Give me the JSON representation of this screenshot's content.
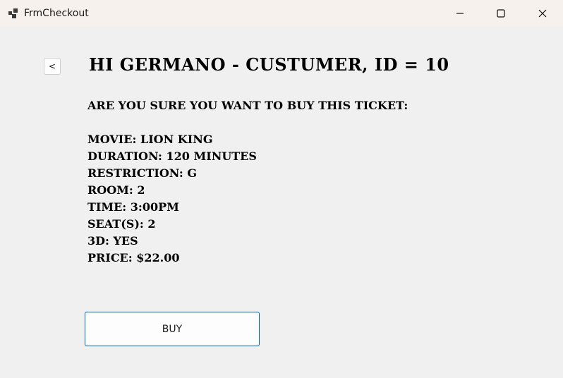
{
  "window": {
    "title": "FrmCheckout"
  },
  "back_button": {
    "label": "<"
  },
  "header": {
    "greeting": "Hi Germano - Custumer, ID = 10"
  },
  "confirmation": {
    "question": "Are you sure you want to buy this ticket:"
  },
  "ticket": {
    "movie": "Movie: Lion King",
    "duration": "Duration: 120 minutes",
    "restriction": "Restriction: G",
    "room": "Room: 2",
    "time": "Time: 3:00PM",
    "seats": "Seat(s): 2",
    "three_d": "3D: Yes",
    "price": "Price: $22.00"
  },
  "buy_button": {
    "label": "BUY"
  },
  "icons": {
    "app": "app-icon",
    "minimize": "minimize-icon",
    "maximize": "maximize-icon",
    "close": "close-icon"
  },
  "colors": {
    "background": "#f0f0f0",
    "titlebar": "#f7f1ee",
    "button_accent": "#0067c0"
  }
}
